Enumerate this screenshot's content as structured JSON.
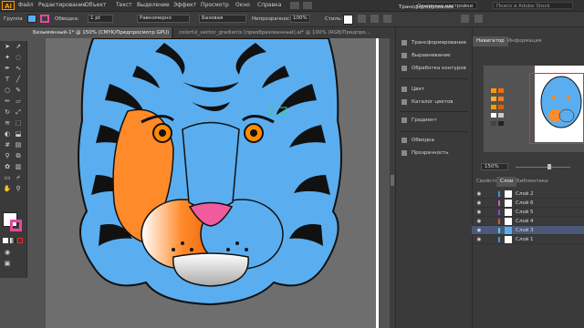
{
  "app": {
    "logo": "Ai"
  },
  "menu": [
    "Файл",
    "Редактирование",
    "Объект",
    "Текст",
    "Выделение",
    "Эффект",
    "Просмотр",
    "Окно",
    "Справка"
  ],
  "workspace": "Основные настройки",
  "search_placeholder": "Поиск в Adobe Stock",
  "control": {
    "group_label": "Группа",
    "stroke_size": "1 pt",
    "stroke_profile": "Равномерно",
    "brush": "Базовая",
    "opacity_label": "Непрозрачность:",
    "opacity_value": "100%",
    "styles_label": "Стиль:",
    "transform_label": "Трансформирование"
  },
  "tabs": {
    "active": "Безымянный-1* @ 150% (CMYK/Предпросмотр GPU)",
    "second": "colorful_vector_gradients [преобразованный].ai* @ 100% (RGB/Предпро..."
  },
  "dock1": {
    "items": [
      "Трансформирование",
      "Выравнивание",
      "Обработка контуров",
      "Цвет",
      "Каталог цветов",
      "Градиент",
      "Обводка",
      "Прозрачность"
    ]
  },
  "navigator": {
    "tabs": [
      "Навигатор",
      "Информация"
    ],
    "zoom": "150%"
  },
  "layers": {
    "tabs": [
      "Свойства",
      "Слои",
      "Библиотеки"
    ],
    "rows": [
      {
        "name": "Слой 2",
        "color": "#4b8be0"
      },
      {
        "name": "Слой 6",
        "color": "#e04bd0"
      },
      {
        "name": "Слой 5",
        "color": "#7a4be0"
      },
      {
        "name": "Слой 4",
        "color": "#e04b4b"
      },
      {
        "name": "Слой 3",
        "color": "#4bd0e0"
      },
      {
        "name": "Слой 1",
        "color": "#4b8be0"
      }
    ]
  },
  "colors": {
    "tiger_blue": "#5aaeef",
    "accent_orange": "#ff9a00",
    "ui_dark": "#323232"
  }
}
